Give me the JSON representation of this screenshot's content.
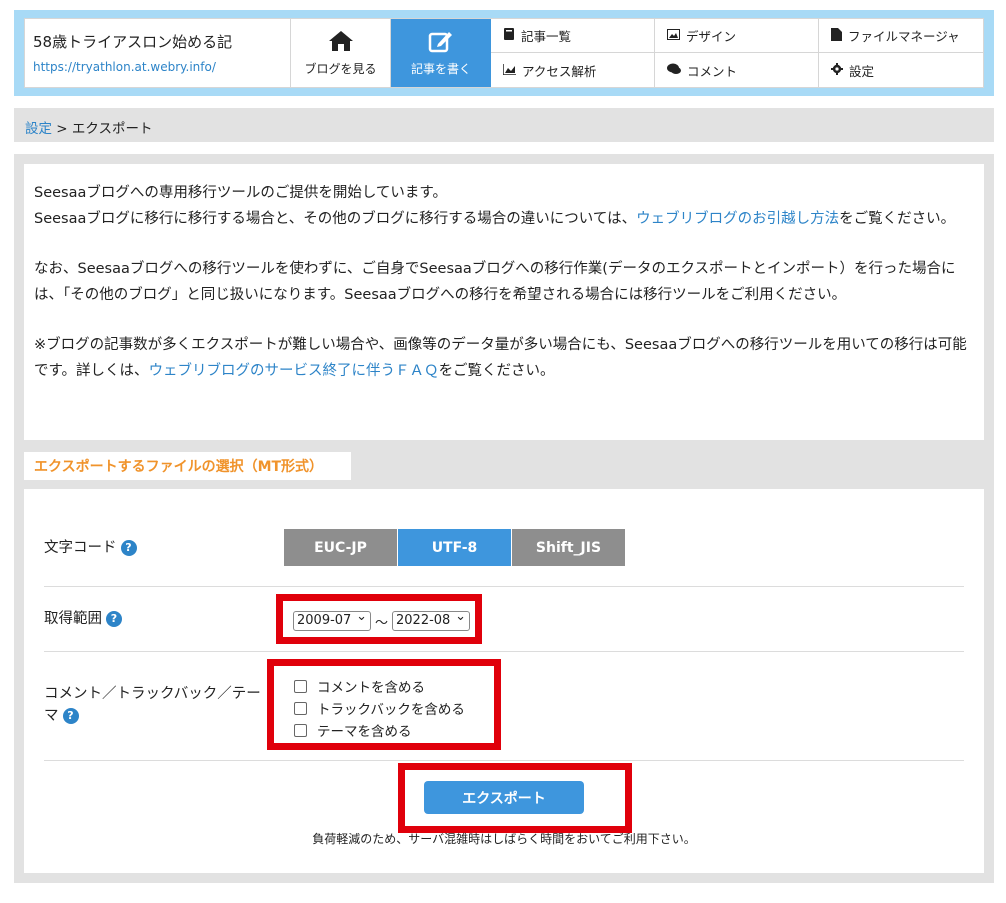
{
  "header": {
    "blog_title": "58歳トライアスロン始める記",
    "blog_url": "https://tryathlon.at.webry.info/",
    "view_blog_label": "ブログを見る",
    "write_post_label": "記事を書く",
    "menu": [
      {
        "icon": "book-icon",
        "label": "記事一覧"
      },
      {
        "icon": "image-icon",
        "label": "デザイン"
      },
      {
        "icon": "file-icon",
        "label": "ファイルマネージャ"
      },
      {
        "icon": "chart-icon",
        "label": "アクセス解析"
      },
      {
        "icon": "comments-icon",
        "label": "コメント"
      },
      {
        "icon": "gear-icon",
        "label": "設定"
      }
    ]
  },
  "breadcrumb": {
    "parent": "設定",
    "separator": " > ",
    "current": "エクスポート"
  },
  "notice": {
    "p1_line1": "Seesaaブログへの専用移行ツールのご提供を開始しています。",
    "p1_line2_pre": "Seesaaブログに移行に移行する場合と、その他のブログに移行する場合の違いについては、",
    "p1_link": "ウェブリブログのお引越し方法",
    "p1_line2_post": "をご覧ください。",
    "p2": "なお、Seesaaブログへの移行ツールを使わずに、ご自身でSeesaaブログへの移行作業(データのエクスポートとインポート）を行った場合には、「その他のブログ」と同じ扱いになります。Seesaaブログへの移行を希望される場合には移行ツールをご利用ください。",
    "p3_pre": "※ブログの記事数が多くエクスポートが難しい場合や、画像等のデータ量が多い場合にも、Seesaaブログへの移行ツールを用いての移行は可能です。詳しくは、",
    "p3_link": "ウェブリブログのサービス終了に伴うＦＡＱ",
    "p3_post": "をご覧ください。"
  },
  "section": {
    "title": "エクスポートするファイルの選択（MT形式）"
  },
  "form": {
    "encoding_label": "文字コード",
    "encodings": [
      "EUC-JP",
      "UTF-8",
      "Shift_JIS"
    ],
    "encoding_selected": "UTF-8",
    "range_label": "取得範囲",
    "range_from": "2009-07",
    "range_sep": "〜",
    "range_to": "2022-08",
    "options_label_1": "コメント／トラックバック／テー",
    "options_label_2": "マ",
    "options": [
      {
        "label": "コメントを含める",
        "checked": false
      },
      {
        "label": "トラックバックを含める",
        "checked": false
      },
      {
        "label": "テーマを含める",
        "checked": false
      }
    ],
    "help_glyph": "?",
    "export_label": "エクスポート",
    "export_note": "負荷軽減のため、サーバ混雑時はしばらく時間をおいてご利用下さい。"
  },
  "colors": {
    "accent": "#3e96dd",
    "header_bg": "#a8daf6",
    "section_title": "#f0932b",
    "highlight": "#e0000b"
  }
}
